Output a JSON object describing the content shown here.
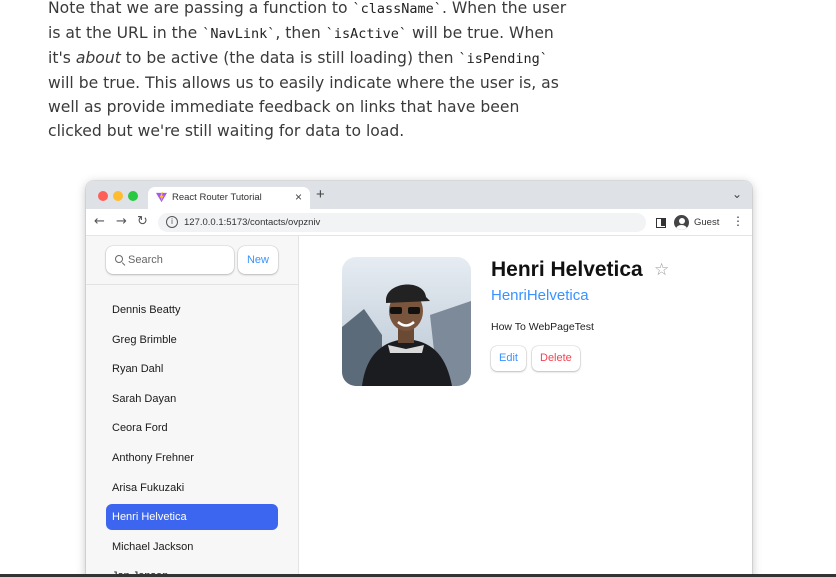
{
  "article": {
    "p1": "Note that we are passing a function to ",
    "code1": "`className`",
    "p2": ". When the user is at the URL in the ",
    "code2": "`NavLink`",
    "p3": ", then ",
    "code3": "`isActive`",
    "p4": " will be true. When it's ",
    "em1": "about",
    "p5": " to be active (the data is still loading) then ",
    "code4": "`isPending`",
    "p6": " will be true. This allows us to easily indicate where the user is, as well as provide immediate feedback on links that have been clicked but we're still waiting for data to load."
  },
  "browser": {
    "tab_title": "React Router Tutorial",
    "tab_close": "×",
    "new_tab": "+",
    "tab_menu": "⌄",
    "back": "←",
    "forward": "→",
    "reload": "↻",
    "info_glyph": "i",
    "url": "127.0.0.1:5173/contacts/ovpzniv",
    "profile_label": "Guest",
    "menu_glyph": "⋮",
    "traffic_light_colors": [
      "#ff5f57",
      "#febc2e",
      "#28c840"
    ]
  },
  "app": {
    "search": {
      "placeholder": "Search"
    },
    "new_button": "New",
    "contacts": [
      "Dennis Beatty",
      "Greg Brimble",
      "Ryan Dahl",
      "Sarah Dayan",
      "Ceora Ford",
      "Anthony Frehner",
      "Arisa Fukuzaki",
      "Henri Helvetica",
      "Michael Jackson",
      "Jon Jensen"
    ],
    "active_contact": "Henri Helvetica",
    "detail": {
      "name": "Henri Helvetica",
      "star": "☆",
      "handle": "HenriHelvetica",
      "notes": "How To WebPageTest",
      "edit_label": "Edit",
      "delete_label": "Delete"
    },
    "colors": {
      "accent": "#3992ff",
      "active": "#3c66f0",
      "danger": "#f44250"
    }
  }
}
